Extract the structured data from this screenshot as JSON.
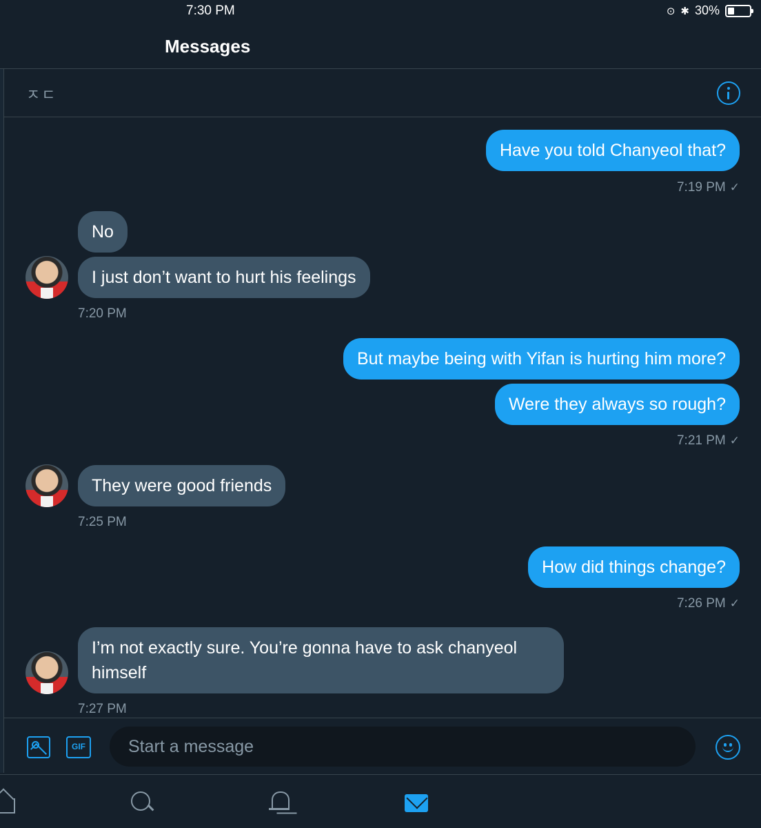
{
  "status_bar": {
    "time": "7:30 PM",
    "battery": "30%",
    "battery_level": 0.3
  },
  "header": {
    "title": "Messages"
  },
  "conversation": {
    "name": "ㅈㄷ",
    "info_icon": "info-icon"
  },
  "messages": [
    {
      "text": "Have you told Chanyeol that?",
      "direction": "outgoing"
    },
    {
      "time": "7:19 PM",
      "status": "✓"
    },
    {
      "text": "No",
      "direction": "incoming"
    },
    {
      "text": "I just don’t want to hurt his feelings",
      "direction": "incoming"
    },
    {
      "time": "7:20 PM"
    },
    {
      "text": "But maybe being with Yifan is hurting him more?",
      "direction": "outgoing"
    },
    {
      "text": "Were they always so rough?",
      "direction": "outgoing"
    },
    {
      "time": "7:21 PM",
      "status": "✓"
    },
    {
      "text": "They were good friends",
      "direction": "incoming"
    },
    {
      "time": "7:25 PM"
    },
    {
      "text": "How did things change?",
      "direction": "outgoing"
    },
    {
      "time": "7:26 PM",
      "status": "✓"
    },
    {
      "text": "I’m not exactly sure. You’re gonna have to ask chanyeol himself",
      "direction": "incoming"
    },
    {
      "time": "7:27 PM"
    }
  ],
  "composer": {
    "placeholder": "Start a message",
    "gif_label": "GIF",
    "icons": [
      "image-icon",
      "gif-icon",
      "emoji-icon"
    ]
  },
  "tab_bar": {
    "icons": [
      "home-icon",
      "search-icon",
      "bell-icon",
      "mail-icon"
    ],
    "active": "mail-icon"
  },
  "colors": {
    "background": "#15202b",
    "accent": "#1da1f2",
    "incoming_bubble": "#3d5466",
    "muted_text": "#8899a6"
  }
}
